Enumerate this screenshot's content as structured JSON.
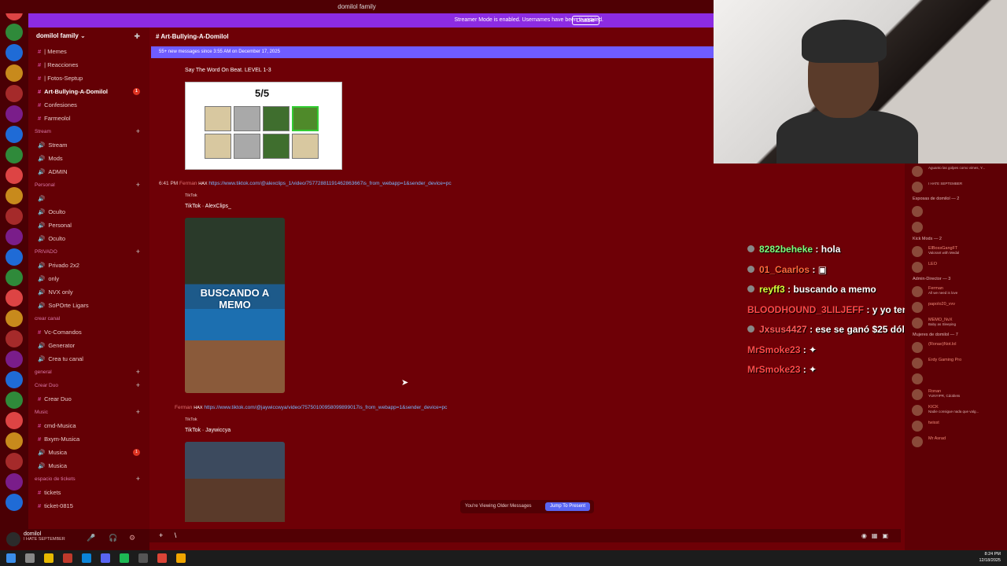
{
  "window": {
    "title": "domilol family"
  },
  "streamer_banner": {
    "text": "Streamer Mode is enabled. Usernames have been truncated.",
    "disable_label": "Disable"
  },
  "server": {
    "name": "domilol family"
  },
  "sidebar": {
    "channels": [
      {
        "label": "| Memes",
        "icon": "hash-icon"
      },
      {
        "label": "| Reacciones",
        "icon": "hash-icon"
      },
      {
        "label": "| Fotos-Septup",
        "icon": "hash-icon"
      },
      {
        "label": "Art-Bullying-A-Domilol",
        "icon": "hash-icon",
        "badge": "1",
        "active": true
      },
      {
        "label": "Confesiones",
        "icon": "hash-icon"
      },
      {
        "label": "Farmeolol",
        "icon": "hash-icon"
      }
    ],
    "categories": [
      {
        "name": "Stream",
        "channels": [
          {
            "label": "Stream"
          },
          {
            "label": "Mods"
          },
          {
            "label": "ADMIN"
          }
        ]
      },
      {
        "name": "Personal",
        "channels": [
          {
            "label": ""
          },
          {
            "label": "Oculto"
          },
          {
            "label": "Personal"
          },
          {
            "label": "Oculto"
          }
        ]
      },
      {
        "name": "PRIVADO",
        "channels": [
          {
            "label": "Privado 2x2"
          },
          {
            "label": "only"
          },
          {
            "label": "NVX only"
          },
          {
            "label": "SoPOrte Ligars"
          }
        ]
      },
      {
        "name": "crear canal",
        "channels": [
          {
            "label": "Vc-Comandos"
          },
          {
            "label": "Generator"
          },
          {
            "label": "Crea tu canal"
          }
        ]
      },
      {
        "name": "general",
        "channels": []
      },
      {
        "name": "Crear Duo",
        "channels": [
          {
            "label": "Crear Duo"
          }
        ]
      },
      {
        "name": "Music",
        "channels": [
          {
            "label": "cmd-Musica"
          },
          {
            "label": "Bxym-Musica"
          },
          {
            "label": "Musica",
            "badge": "1"
          },
          {
            "label": "Musica"
          }
        ]
      },
      {
        "name": "espacio de tickets",
        "channels": [
          {
            "label": "tickets"
          },
          {
            "label": "ticket-0815"
          }
        ]
      }
    ]
  },
  "user_panel": {
    "name": "domilol",
    "status": "I HATE SEPTEMBER"
  },
  "channel_header": {
    "name": "Art-Bullying-A-Domilol"
  },
  "new_messages_bar": {
    "text": "55+ new messages since 3:55 AM on December 17, 2025"
  },
  "messages": {
    "game_title": "Say The Word On Beat. LEVEL 1-3",
    "game_score": "5/5",
    "msg1": {
      "time": "6:41 PM",
      "author": "Ferman",
      "tag": "HAX",
      "link": "https://www.tiktok.com/@alexclips_1/video/75772881191462863667is_from_webapp=1&sender_device=pc"
    },
    "embed1": {
      "provider": "TikTok",
      "title": "TikTok · AlexClips_",
      "video_text": "BUSCANDO A MEMO"
    },
    "msg2": {
      "author": "Ferman",
      "tag": "HAX",
      "link": "https://www.tiktok.com/@jaywiccwya/video/75750100958099899017is_from_webapp=1&sender_device=pc"
    },
    "embed2": {
      "provider": "TikTok",
      "title": "TikTok · Jaywiccya"
    }
  },
  "older_messages": {
    "text": "You're Viewing Older Messages",
    "jump_label": "Jump To Present"
  },
  "composer": {
    "plus_label": "+",
    "value": "\\"
  },
  "chat_overlay": [
    {
      "user": "8282beheke",
      "text": "hola",
      "color": "#7cff7c"
    },
    {
      "user": "01_Caarlos",
      "text": "",
      "color": "#ff6a3d"
    },
    {
      "user": "reyff3",
      "text": "buscando a memo",
      "color": "#d4ff3a"
    },
    {
      "user": "BLOODHOUND_3LILJEFF",
      "text": "y yo tengo mod",
      "color": "#ff4a4a"
    },
    {
      "user": "Jxsus4427",
      "text": "ese se ganó $25 dólares fácil ahí",
      "color": "#ff5a5a"
    },
    {
      "user": "MrSmoke23",
      "text": "",
      "color": "#ff4a4a"
    },
    {
      "user": "MrSmoke23",
      "text": "",
      "color": "#ff4a4a"
    }
  ],
  "members": {
    "groups": [
      {
        "name": "",
        "items": [
          {
            "name": "",
            "status": "Aguanto las golpes como vimes, Y..."
          },
          {
            "name": "",
            "status": "I HATE SEPTEMBER"
          }
        ]
      },
      {
        "name": "Esposas de domilol — 2",
        "items": [
          {
            "name": "",
            "status": ""
          },
          {
            "name": "",
            "status": ""
          }
        ]
      },
      {
        "name": "Kick Mods — 2",
        "items": [
          {
            "name": "ElBossGangFT",
            "status": "Valorant with Medal"
          },
          {
            "name": "LEO",
            "status": ""
          }
        ]
      },
      {
        "name": "Admin-Director — 3",
        "items": [
          {
            "name": "Ferman",
            "status": "All we need is love"
          },
          {
            "name": "papolo20_vvv",
            "status": ""
          },
          {
            "name": "MEMO_NvX",
            "status": "Baby as Sleeping"
          }
        ]
      },
      {
        "name": "Mujeres de domilol — 7",
        "items": [
          {
            "name": "(Ronao)Not.lol",
            "status": ""
          },
          {
            "name": "Erdy Gaming Pro",
            "status": ""
          },
          {
            "name": "",
            "status": ""
          },
          {
            "name": "Ronan",
            "status": "YUNYIPR, Cdoblets"
          },
          {
            "name": "KICK",
            "status": "Nadie consigue nada que valg..."
          },
          {
            "name": "twisst",
            "status": ""
          },
          {
            "name": "Mr Asrad",
            "status": ""
          }
        ]
      }
    ]
  },
  "taskbar": {
    "time": "8:24 PM",
    "date": "12/18/2025"
  }
}
